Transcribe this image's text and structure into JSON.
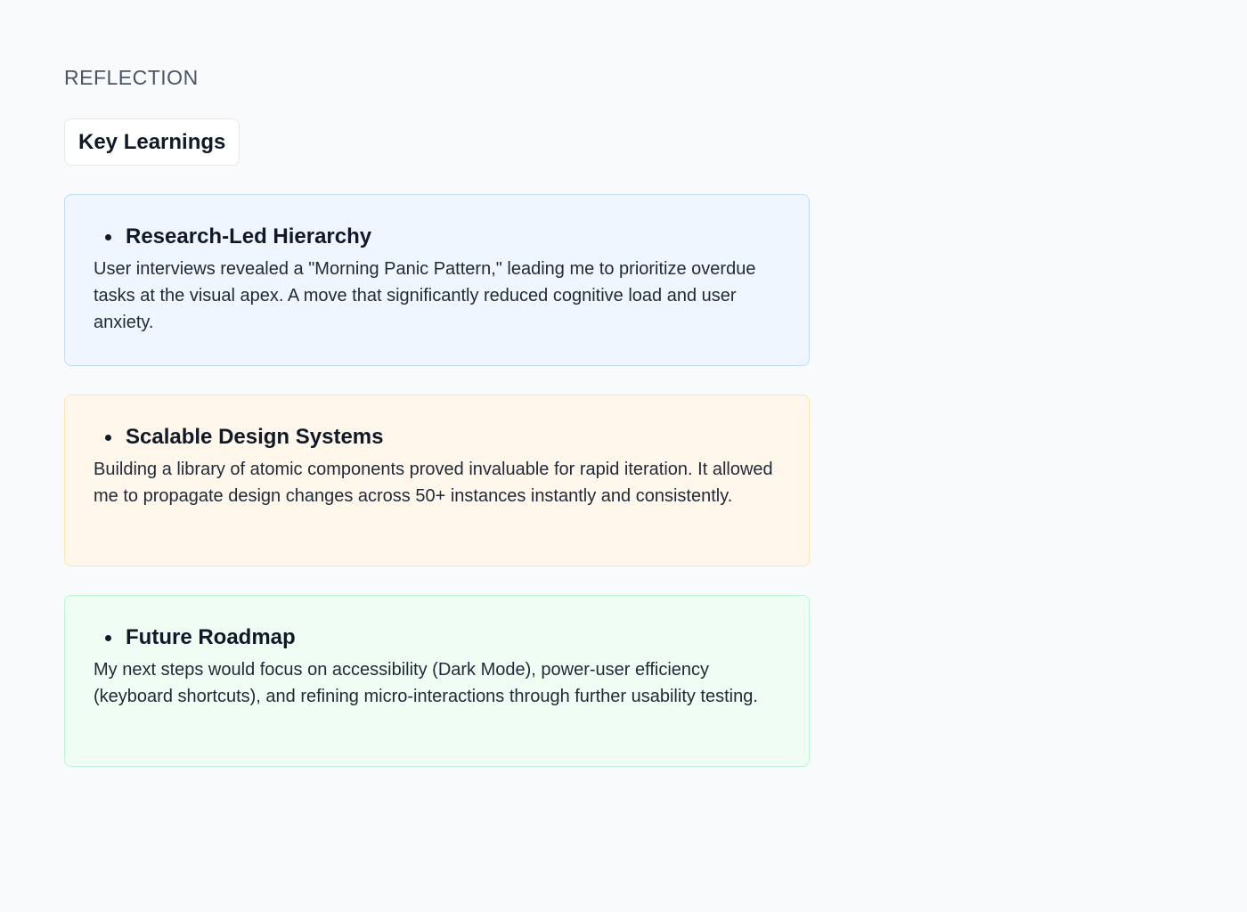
{
  "section": {
    "eyebrow": "REFLECTION",
    "title": "Key Learnings"
  },
  "cards": [
    {
      "title": "Research-Led Hierarchy",
      "body": "User interviews revealed a \"Morning Panic Pattern,\" leading me to prioritize overdue tasks at the visual apex. A move that significantly reduced cognitive load and user anxiety.",
      "accent": "#eff6ff"
    },
    {
      "title": "Scalable Design Systems",
      "body": "Building a library of atomic components proved invaluable for rapid iteration. It allowed me to propagate design changes across 50+ instances instantly and consistently.",
      "accent": "#fff7eb"
    },
    {
      "title": "Future Roadmap",
      "body": "My next steps would focus on accessibility (Dark Mode), power-user efficiency (keyboard shortcuts), and refining micro-interactions through further usability testing.",
      "accent": "#f0fdf4"
    }
  ]
}
